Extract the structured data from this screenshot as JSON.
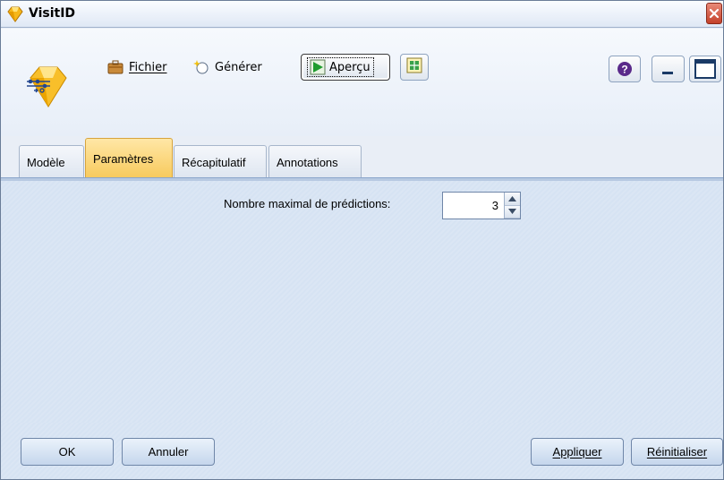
{
  "window": {
    "title": "VisitID"
  },
  "toolbar": {
    "fichier_label": "Fichier",
    "generer_label": "Générer",
    "apercu_label": "Aperçu"
  },
  "tabs": [
    {
      "label": "Modèle",
      "active": false
    },
    {
      "label": "Paramètres",
      "active": true
    },
    {
      "label": "Récapitulatif",
      "active": false
    },
    {
      "label": "Annotations",
      "active": false
    }
  ],
  "parameters": {
    "max_predictions_label": "Nombre maximal de prédictions:",
    "max_predictions_value": "3"
  },
  "buttons": {
    "ok": "OK",
    "cancel": "Annuler",
    "apply": "Appliquer",
    "reset": "Réinitialiser"
  },
  "icons": {
    "title": "diamond-model-icon",
    "node": "model-node-icon",
    "fichier": "briefcase-icon",
    "generer": "sparkle-icon",
    "apercu": "play-preview-icon",
    "extra": "table-grid-icon",
    "help": "help-icon",
    "minimize": "minimize-icon",
    "maximize": "maximize-icon",
    "close": "close-icon"
  },
  "colors": {
    "active_tab": "#f7c95a",
    "content_bg": "#d6e3f3",
    "close_button": "#c4412a"
  }
}
